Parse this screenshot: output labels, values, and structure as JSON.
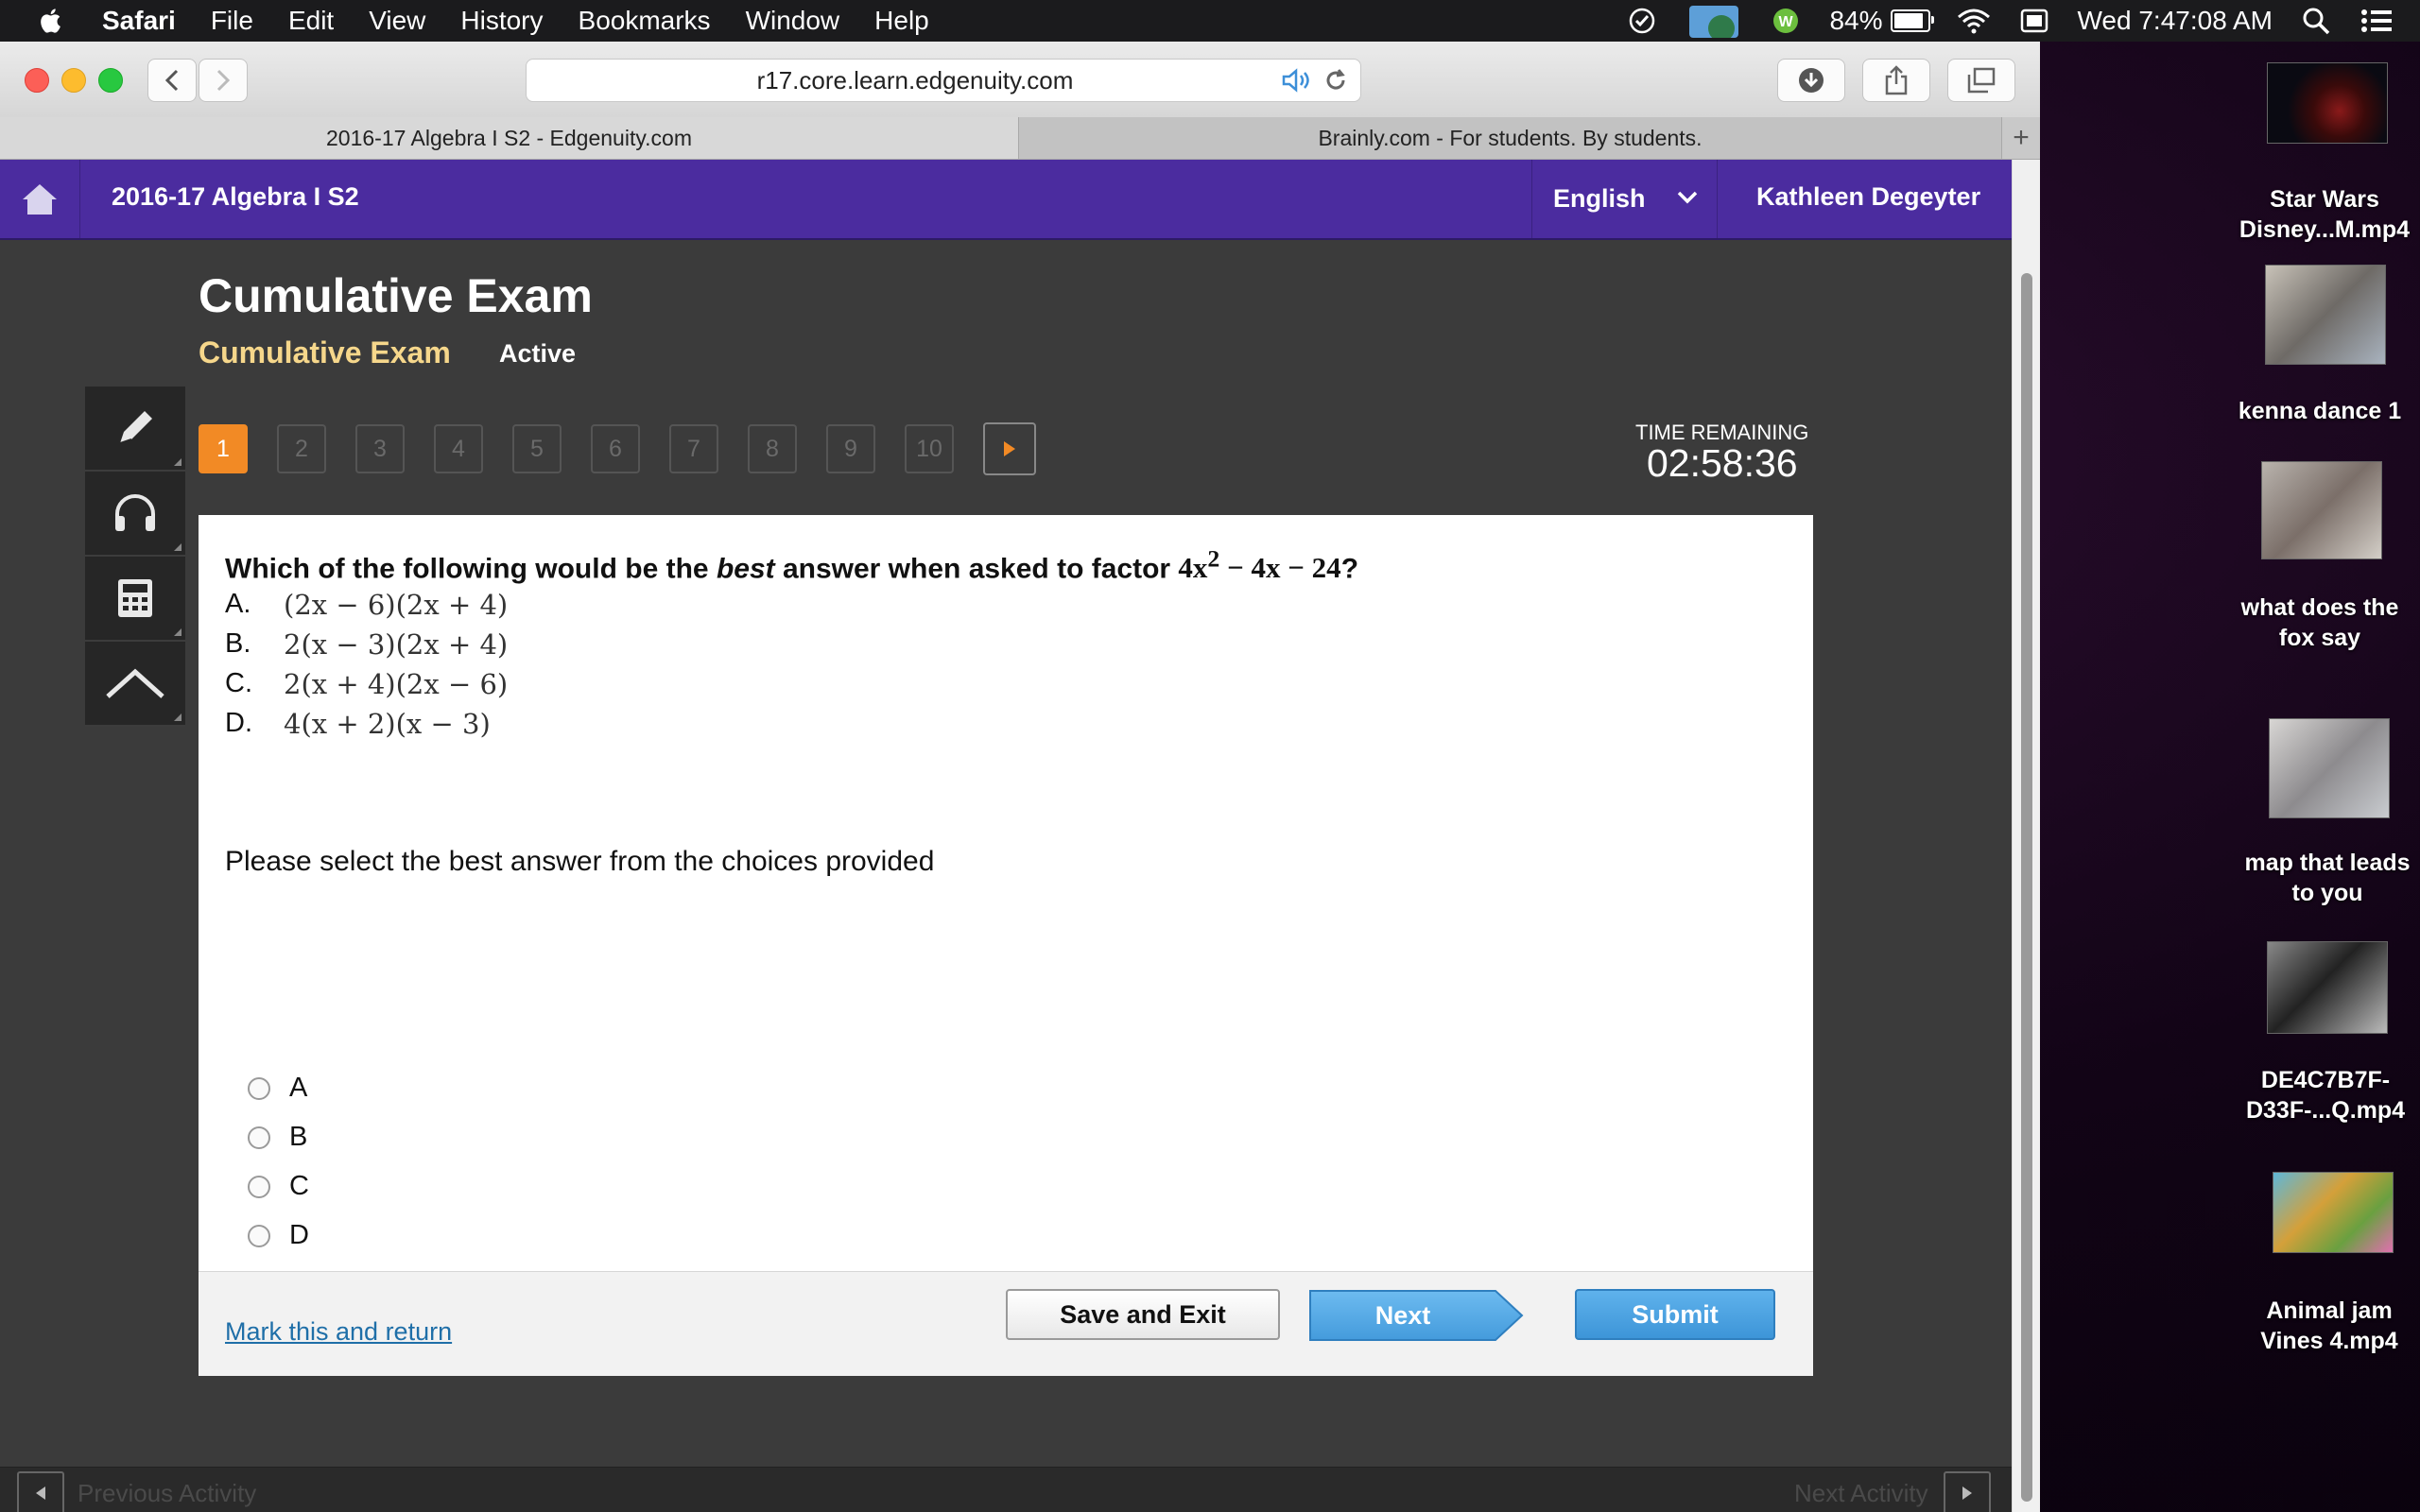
{
  "menubar": {
    "app": "Safari",
    "items": [
      "File",
      "Edit",
      "View",
      "History",
      "Bookmarks",
      "Window",
      "Help"
    ],
    "battery": "84%",
    "clock": "Wed 7:47:08 AM"
  },
  "browser": {
    "url": "r17.core.learn.edgenuity.com",
    "tabs": [
      {
        "label": "2016-17 Algebra I S2 - Edgenuity.com",
        "active": true
      },
      {
        "label": "Brainly.com - For students. By students.",
        "active": false
      }
    ]
  },
  "app_header": {
    "course": "2016-17 Algebra I S2",
    "language": "English",
    "user": "Kathleen Degeyter"
  },
  "exam": {
    "title": "Cumulative Exam",
    "subtitle": "Cumulative Exam",
    "status": "Active",
    "questions": [
      "1",
      "2",
      "3",
      "4",
      "5",
      "6",
      "7",
      "8",
      "9",
      "10"
    ],
    "current_question": 1,
    "time_label": "TIME REMAINING",
    "time_value": "02:58:36"
  },
  "question": {
    "prefix": "Which of the following would be the ",
    "emphasis": "best",
    "suffix": " answer when asked to factor ",
    "expression_html": "4x<sup>2</sup> − 4x − 24",
    "end": "?",
    "choices": [
      {
        "letter": "A.",
        "expr": "(2x − 6)(2x + 4)"
      },
      {
        "letter": "B.",
        "expr": "2(x − 3)(2x + 4)"
      },
      {
        "letter": "C.",
        "expr": "2(x + 4)(2x − 6)"
      },
      {
        "letter": "D.",
        "expr": "4(x + 2)(x − 3)"
      }
    ],
    "prompt": "Please select the best answer from the choices provided",
    "options": [
      "A",
      "B",
      "C",
      "D"
    ]
  },
  "footer": {
    "mark": "Mark this and return",
    "save": "Save and Exit",
    "next": "Next",
    "submit": "Submit"
  },
  "activity_nav": {
    "previous": "Previous Activity",
    "next": "Next Activity"
  },
  "desktop_files": [
    {
      "line1": "Star Wars",
      "line2": "Disney...M.mp4"
    },
    {
      "line1": "kenna dance 1",
      "line2": ""
    },
    {
      "line1": "what does the",
      "line2": "fox say"
    },
    {
      "line1": "map that leads",
      "line2": "to you"
    },
    {
      "line1": "DE4C7B7F-",
      "line2": "D33F-...Q.mp4"
    },
    {
      "line1": "Animal jam",
      "line2": "Vines 4.mp4"
    }
  ],
  "colors": {
    "header": "#4b2c9f",
    "current_question": "#f28a25",
    "subtitle": "#f6d78b",
    "submit": "#3d95d8"
  }
}
